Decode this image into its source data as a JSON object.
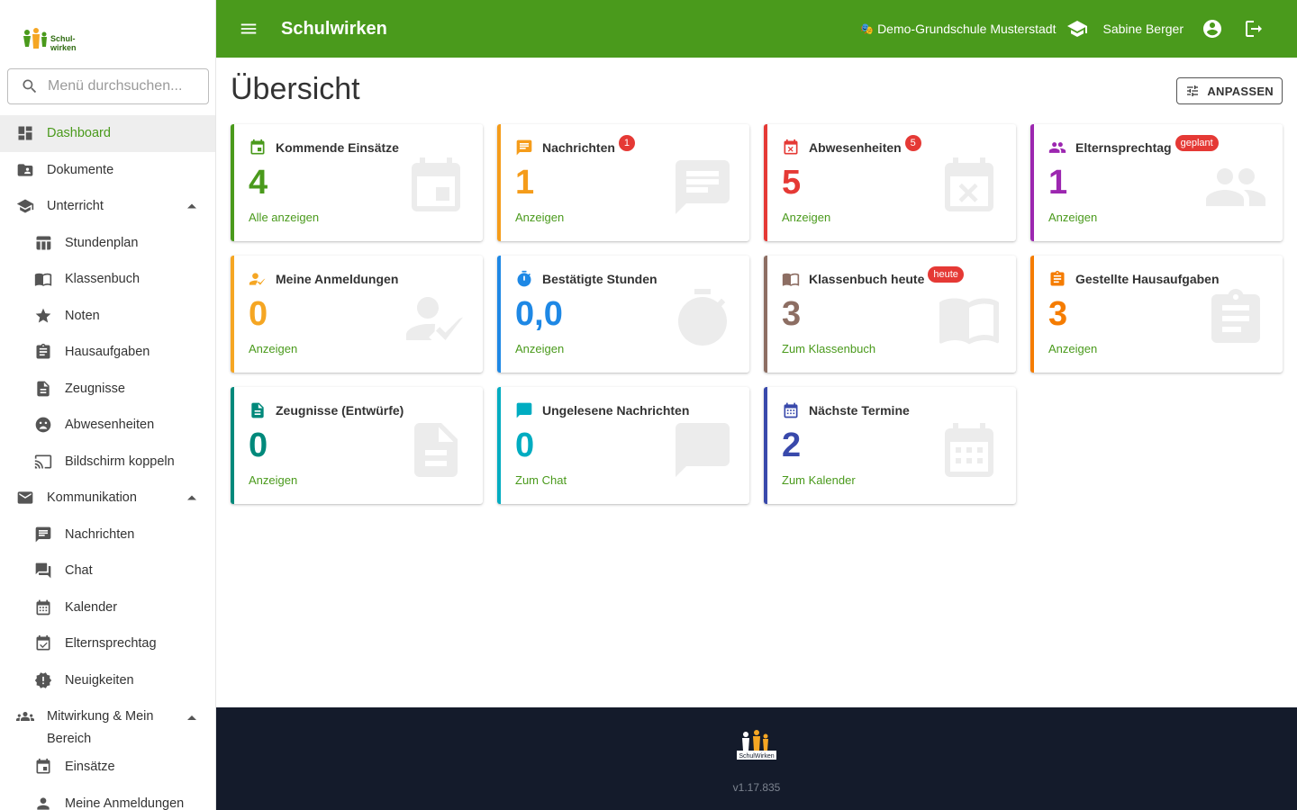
{
  "app": {
    "title": "Schulwirken"
  },
  "header": {
    "school": "Demo-Grundschule Musterstadt",
    "user": "Sabine Berger"
  },
  "sidebar": {
    "search_placeholder": "Menü durchsuchen...",
    "items": [
      {
        "label": "Dashboard",
        "icon": "dashboard-icon"
      },
      {
        "label": "Dokumente",
        "icon": "folder-icon"
      },
      {
        "label": "Unterricht",
        "icon": "school-icon"
      },
      {
        "label": "Stundenplan",
        "icon": "table-icon"
      },
      {
        "label": "Klassenbuch",
        "icon": "book-icon"
      },
      {
        "label": "Noten",
        "icon": "star-icon"
      },
      {
        "label": "Hausaufgaben",
        "icon": "clipboard-icon"
      },
      {
        "label": "Zeugnisse",
        "icon": "document-icon"
      },
      {
        "label": "Abwesenheiten",
        "icon": "sad-face-icon"
      },
      {
        "label": "Bildschirm koppeln",
        "icon": "cast-icon"
      },
      {
        "label": "Kommunikation",
        "icon": "mail-icon"
      },
      {
        "label": "Nachrichten",
        "icon": "message-icon"
      },
      {
        "label": "Chat",
        "icon": "forum-icon"
      },
      {
        "label": "Kalender",
        "icon": "calendar-icon"
      },
      {
        "label": "Elternsprechtag",
        "icon": "event-check-icon"
      },
      {
        "label": "Neuigkeiten",
        "icon": "news-badge-icon"
      },
      {
        "label": "Mitwirkung & Mein Bereich",
        "icon": "group-icon"
      },
      {
        "label": "Einsätze",
        "icon": "event-icon"
      },
      {
        "label": "Meine Anmeldungen",
        "icon": "person-icon"
      }
    ]
  },
  "main": {
    "title": "Übersicht",
    "customize_label": "ANPASSEN",
    "cards": [
      {
        "title": "Kommende Einsätze",
        "value": "4",
        "link": "Alle anzeigen",
        "color": "#4a9a1c"
      },
      {
        "title": "Nachrichten",
        "badge": "1",
        "value": "1",
        "link": "Anzeigen",
        "color": "#f59c1a"
      },
      {
        "title": "Abwesenheiten",
        "badge": "5",
        "value": "5",
        "link": "Anzeigen",
        "color": "#e53935"
      },
      {
        "title": "Elternsprechtag",
        "badge": "geplant",
        "value": "1",
        "link": "Anzeigen",
        "color": "#9c27b0"
      },
      {
        "title": "Meine Anmeldungen",
        "value": "0",
        "link": "Anzeigen",
        "color": "#f5a623"
      },
      {
        "title": "Bestätigte Stunden",
        "value": "0,0",
        "link": "Anzeigen",
        "color": "#1e88e5"
      },
      {
        "title": "Klassenbuch heute",
        "badge": "heute",
        "value": "3",
        "link": "Zum Klassenbuch",
        "color": "#8d6e63"
      },
      {
        "title": "Gestellte Hausaufgaben",
        "value": "3",
        "link": "Anzeigen",
        "color": "#f57c00"
      },
      {
        "title": "Zeugnisse (Entwürfe)",
        "value": "0",
        "link": "Anzeigen",
        "color": "#00897b"
      },
      {
        "title": "Ungelesene Nachrichten",
        "value": "0",
        "link": "Zum Chat",
        "color": "#00acc1"
      },
      {
        "title": "Nächste Termine",
        "value": "2",
        "link": "Zum Kalender",
        "color": "#3949ab"
      }
    ]
  },
  "footer": {
    "version": "v1.17.835"
  }
}
